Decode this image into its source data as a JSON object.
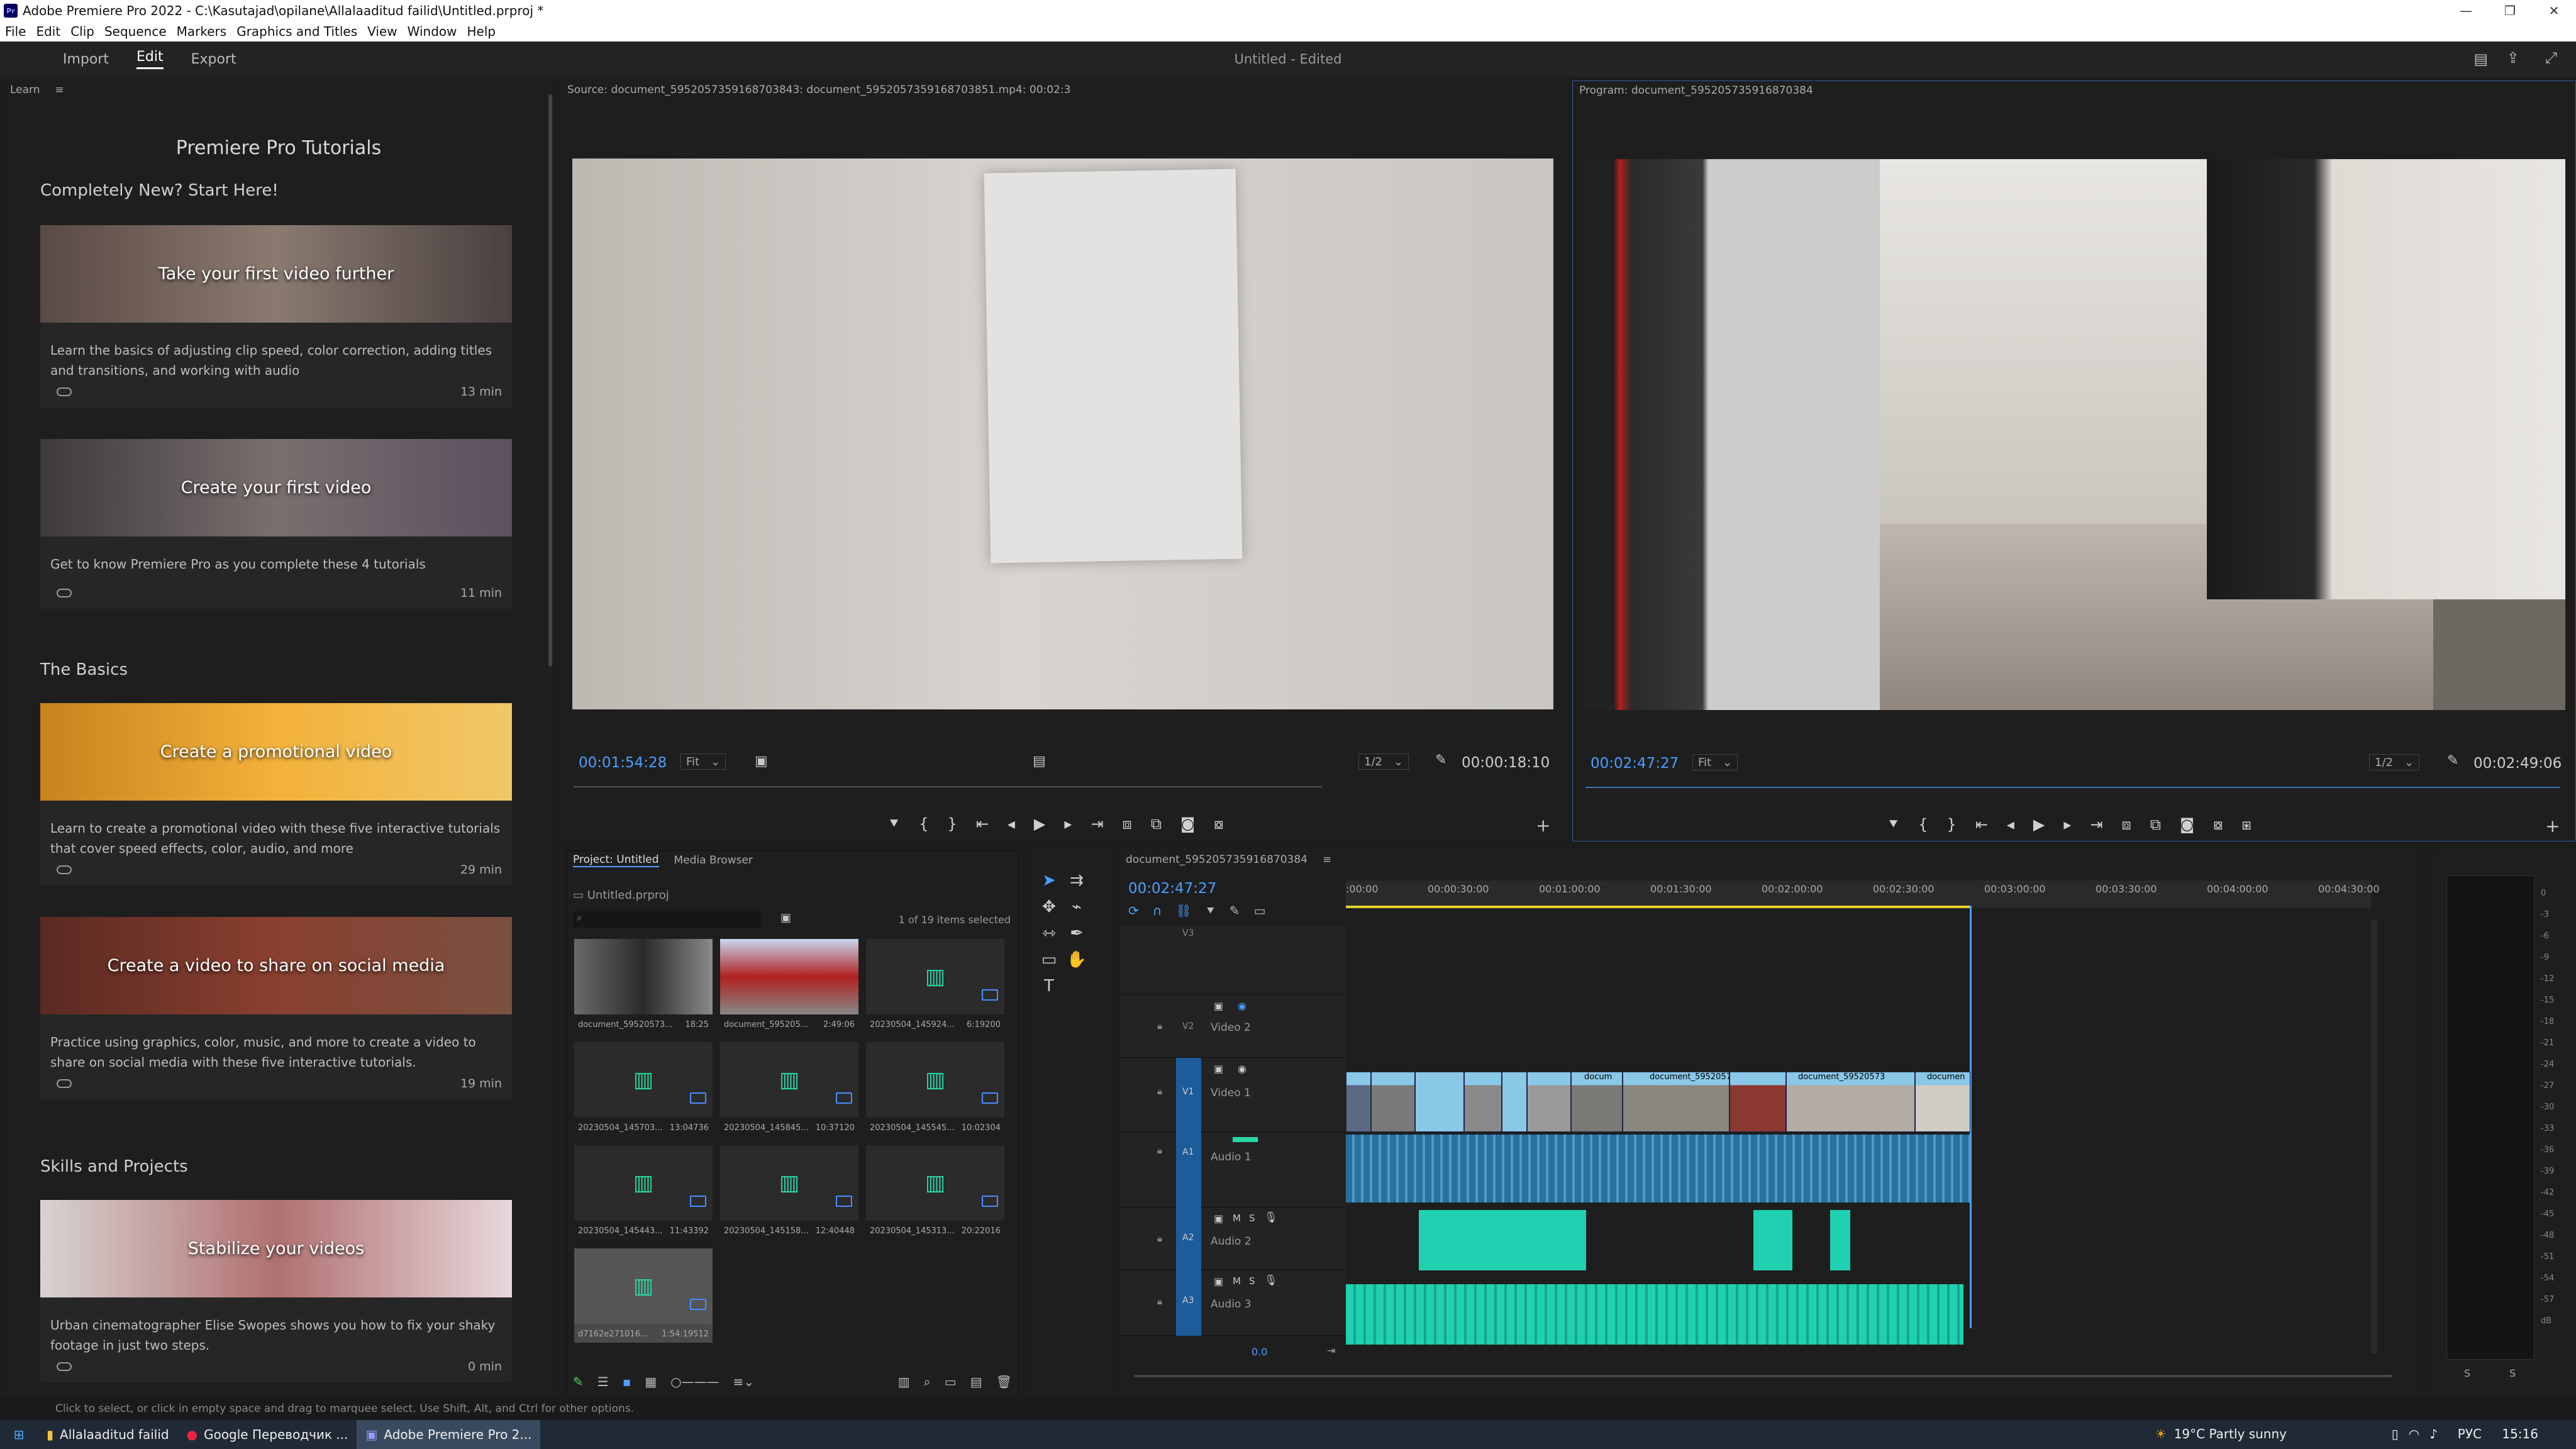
{
  "window": {
    "title": "Adobe Premiere Pro 2022 - C:\\Kasutajad\\opilane\\Allalaaditud failid\\Untitled.prproj *",
    "controls": [
      "—",
      "❐",
      "✕"
    ]
  },
  "menu": [
    "File",
    "Edit",
    "Clip",
    "Sequence",
    "Markers",
    "Graphics and Titles",
    "View",
    "Window",
    "Help"
  ],
  "appbar": {
    "tabs": [
      "Import",
      "Edit",
      "Export"
    ],
    "active_tab": "Edit",
    "project_name": "Untitled",
    "edited": " - Edited"
  },
  "learn": {
    "panel_label": "Learn",
    "title": "Premiere Pro Tutorials",
    "sections": [
      "Completely New? Start Here!",
      "The Basics",
      "Skills and Projects"
    ],
    "cards": [
      {
        "title": "Take your first video further",
        "desc": "Learn the basics of adjusting clip speed, color correction, adding titles and transitions, and working with audio",
        "duration": "13 min"
      },
      {
        "title": "Create your first video",
        "desc": "Get to know Premiere Pro as you complete these 4 tutorials",
        "duration": "11 min"
      },
      {
        "title": "Create a promotional video",
        "desc": "Learn to create a promotional video with these five interactive tutorials that cover speed effects, color, audio, and more",
        "duration": "29 min"
      },
      {
        "title": "Create a video to share on social media",
        "desc": "Practice using graphics, color, music, and more to create a video to share on social media with these five interactive tutorials.",
        "duration": "19 min"
      },
      {
        "title": "Stabilize your videos",
        "desc": "Urban cinematographer Elise Swopes shows you how to fix your shaky footage in just two steps.",
        "duration": "0 min"
      }
    ]
  },
  "source": {
    "label": "Source: document_5952057359168703843: document_5952057359168703851.mp4: 00:02:3",
    "timecode": "00:01:54:28",
    "fit": "Fit",
    "resolution": "1/2",
    "duration": "00:00:18:10"
  },
  "program": {
    "label": "Program: document_595205735916870384",
    "timecode": "00:02:47:27",
    "fit": "Fit",
    "resolution": "1/2",
    "duration": "00:02:49:06"
  },
  "project": {
    "tab": "Project: Untitled",
    "tab2": "Media Browser",
    "file": "Untitled.prproj",
    "selection": "1 of 19 items selected",
    "items": [
      {
        "name": "document_59520573...",
        "dur": "18:25",
        "type": "video"
      },
      {
        "name": "document_595205...",
        "dur": "2:49:06",
        "type": "video"
      },
      {
        "name": "20230504_145924...",
        "dur": "6:19200",
        "type": "audio"
      },
      {
        "name": "20230504_145703...",
        "dur": "13:04736",
        "type": "audio"
      },
      {
        "name": "20230504_145845...",
        "dur": "10:37120",
        "type": "audio"
      },
      {
        "name": "20230504_145545...",
        "dur": "10:02304",
        "type": "audio"
      },
      {
        "name": "20230504_145443...",
        "dur": "11:43392",
        "type": "audio"
      },
      {
        "name": "20230504_145158...",
        "dur": "12:40448",
        "type": "audio"
      },
      {
        "name": "20230504_145313...",
        "dur": "20:22016",
        "type": "audio"
      },
      {
        "name": "d7162e271016...",
        "dur": "1:54:19512",
        "type": "audio"
      }
    ]
  },
  "timeline": {
    "tab": "document_595205735916870384",
    "timecode": "00:02:47:27",
    "ruler": [
      ":00:00",
      "00:00:30:00",
      "00:01:00:00",
      "00:01:30:00",
      "00:02:00:00",
      "00:02:30:00",
      "00:03:00:00",
      "00:03:30:00",
      "00:04:00:00",
      "00:04:30:00"
    ],
    "tracks": [
      {
        "id": "V3",
        "name": ""
      },
      {
        "id": "V2",
        "name": "Video 2"
      },
      {
        "id": "V1",
        "name": "Video 1"
      },
      {
        "id": "A1",
        "name": "Audio 1"
      },
      {
        "id": "A2",
        "name": "Audio 2"
      },
      {
        "id": "A3",
        "name": "Audio 3"
      }
    ],
    "clip_labels": [
      "docum",
      "document_59520573",
      "document_59520573",
      "documen"
    ],
    "volume": "0.0"
  },
  "meter": {
    "scale": [
      "0",
      "-3",
      "-6",
      "-9",
      "-12",
      "-15",
      "-18",
      "-21",
      "-24",
      "-27",
      "-30",
      "-33",
      "-36",
      "-39",
      "-42",
      "-45",
      "-48",
      "-51",
      "-54",
      "-57",
      "dB"
    ],
    "solo": [
      "S",
      "S"
    ]
  },
  "status": "Click to select, or click in empty space and drag to marquee select. Use Shift, Alt, and Ctrl for other options.",
  "taskbar": {
    "tasks": [
      "Allalaaditud failid",
      "Google Переводчик ...",
      "Adobe Premiere Pro 2..."
    ],
    "weather": "19°C  Partly sunny",
    "lang": "РУС",
    "time": "15:16"
  },
  "colors": {
    "accent": "#4a9fff",
    "audio_green": "#29d9a5",
    "video_clip": "#8ac8e8"
  }
}
